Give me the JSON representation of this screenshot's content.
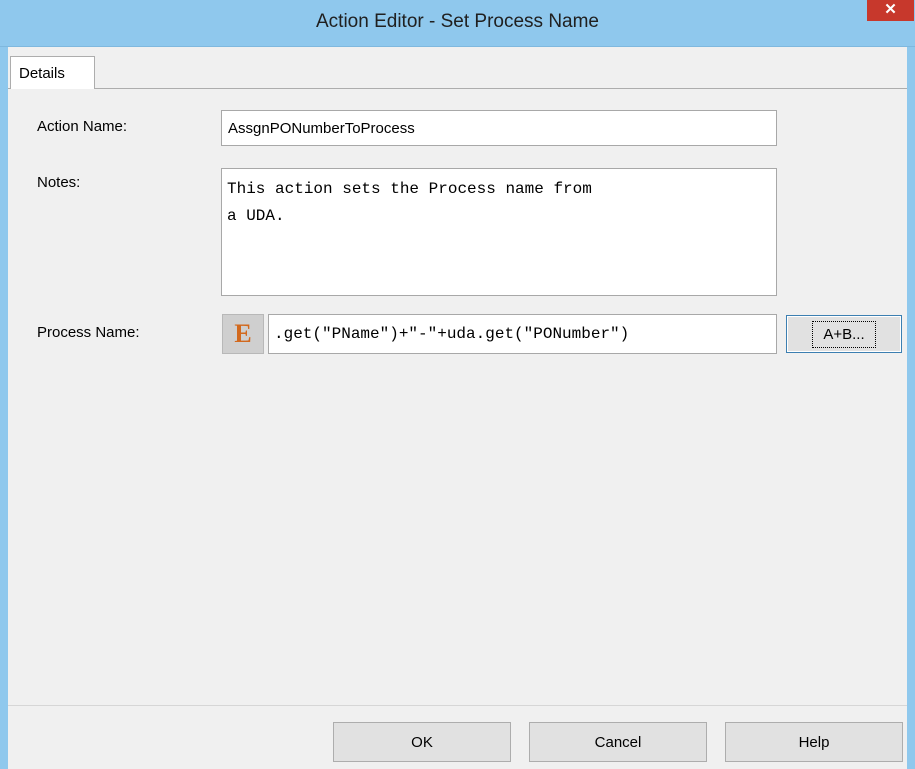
{
  "window": {
    "title": "Action Editor - Set Process Name",
    "close_label": "✕"
  },
  "tabs": [
    {
      "label": "Details"
    }
  ],
  "form": {
    "action_name_label": "Action Name:",
    "action_name_value": "AssgnPONumberToProcess",
    "notes_label": "Notes:",
    "notes_value": "This action sets the Process name from\na UDA.",
    "process_name_label": "Process Name:",
    "expression_icon_text": "E",
    "process_name_value": ".get(\"PName\")+\"-\"+uda.get(\"PONumber\")",
    "expression_builder_label": "A+B..."
  },
  "footer": {
    "ok_label": "OK",
    "cancel_label": "Cancel",
    "help_label": "Help"
  }
}
